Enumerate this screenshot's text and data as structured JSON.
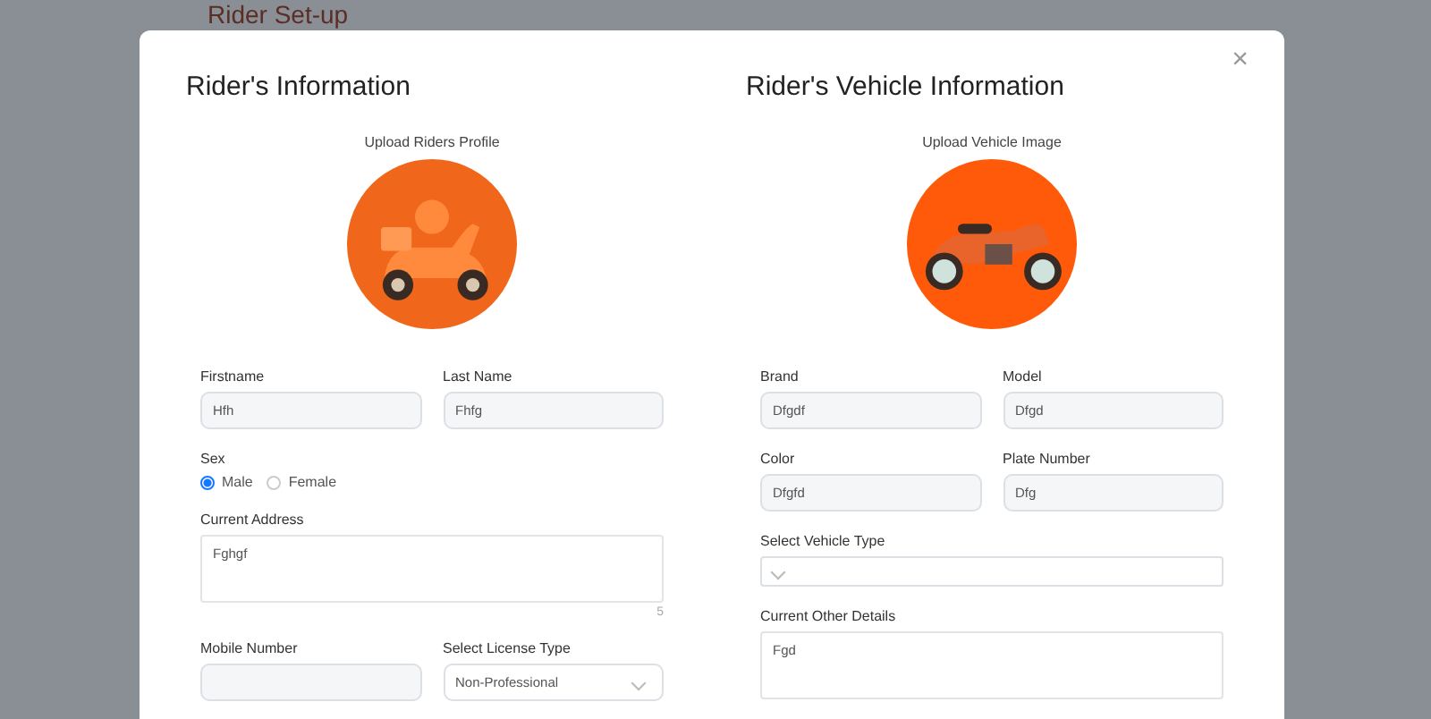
{
  "backdrop": {
    "title": "Rider Set-up"
  },
  "modal": {
    "close": "×",
    "sections": [
      {
        "title": "Rider's Information",
        "upload_label": "Upload Riders Profile",
        "fields": [
          {
            "kind": "pair",
            "items": [
              {
                "label": "Firstname",
                "value": "Hfh"
              },
              {
                "label": "Last Name",
                "value": "Fhfg"
              }
            ]
          },
          {
            "kind": "radio",
            "label": "Sex",
            "options": [
              {
                "label": "Male",
                "selected": true
              },
              {
                "label": "Female",
                "selected": false
              }
            ]
          },
          {
            "kind": "textarea",
            "label": "Current Address",
            "value": "Fghgf",
            "count": "5"
          },
          {
            "kind": "pair",
            "items": [
              {
                "kind": "input",
                "label": "Mobile Number"
              },
              {
                "kind": "select",
                "label": "Select License Type",
                "value": "Non-Professional"
              }
            ]
          }
        ]
      },
      {
        "title": "Rider's Vehicle Information",
        "upload_label": "Upload Vehicle Image",
        "fields": [
          {
            "kind": "pair",
            "items": [
              {
                "label": "Brand",
                "value": "Dfgdf"
              },
              {
                "label": "Model",
                "value": "Dfgd"
              }
            ]
          },
          {
            "kind": "pair",
            "items": [
              {
                "label": "Color",
                "value": "Dfgfd"
              },
              {
                "label": "Plate Number",
                "value": "Dfg"
              }
            ]
          },
          {
            "kind": "select",
            "label": "Select Vehicle Type"
          },
          {
            "kind": "textarea",
            "label": "Current Other Details",
            "value": "Fgd"
          }
        ]
      }
    ]
  }
}
